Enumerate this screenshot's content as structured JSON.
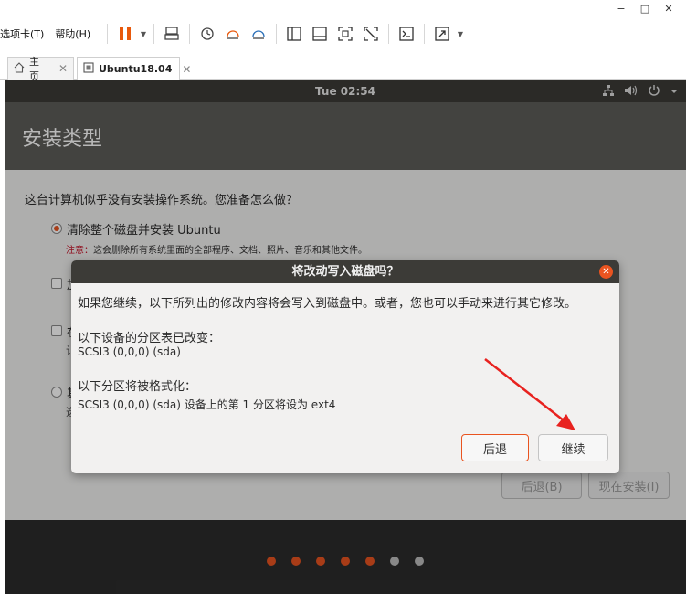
{
  "window": {
    "minimize": "−",
    "maximize": "□",
    "close": "✕"
  },
  "menu": {
    "items": [
      "选项卡(T)",
      "帮助(H)"
    ]
  },
  "toolbar": {
    "icons": [
      "pause-icon",
      "send-keys-icon",
      "snapshot-icon",
      "snapshot-restore-icon",
      "snapshot-manager-icon",
      "view-sidebar-icon",
      "view-console-icon",
      "view-fullscreen-icon",
      "view-unity-icon",
      "terminal-icon",
      "stretch-icon"
    ],
    "accent": "#e95420"
  },
  "tabs": [
    {
      "label": "主页",
      "icon": "home-icon",
      "close": "✕"
    },
    {
      "label": "Ubuntu18.04",
      "icon": "vm-icon",
      "close": "✕"
    }
  ],
  "vm": {
    "clock": "Tue 02:54",
    "tray": [
      "network-icon",
      "volume-icon",
      "power-icon",
      "chevron-down-icon"
    ]
  },
  "installer": {
    "title": "安装类型",
    "question": "这台计算机似乎没有安装操作系统。您准备怎么做？",
    "options": [
      {
        "label": "清除整个磁盘并安装 Ubuntu",
        "selected": true
      },
      {
        "label": "加",
        "selected": false
      },
      {
        "label": "在",
        "selected": false
      },
      {
        "label": "其",
        "selected": false
      }
    ],
    "partials": [
      "　",
      "让",
      "选"
    ],
    "note_prefix": "注意：",
    "note": "这会删除所有系统里面的全部程序、文档、照片、音乐和其他文件。",
    "back_button": "后退(B)",
    "install_button": "现在安装(I)"
  },
  "progress_dots": {
    "total": 7,
    "done": 5,
    "active_color": "#e95420",
    "inactive_color": "#bdbdbd"
  },
  "dialog": {
    "title": "将改动写入磁盘吗？",
    "close": "✕",
    "intro": "如果您继续，以下所列出的修改内容将会写入到磁盘中。或者，您也可以手动来进行其它修改。",
    "partition_heading": "以下设备的分区表已改变：",
    "partition_device": "SCSI3 (0,0,0) (sda)",
    "format_heading": "以下分区将被格式化：",
    "format_detail": "SCSI3 (0,0,0) (sda) 设备上的第 1 分区将设为 ext4",
    "back_button": "后退",
    "continue_button": "继续"
  },
  "annotation": {
    "color": "#e8221f"
  }
}
